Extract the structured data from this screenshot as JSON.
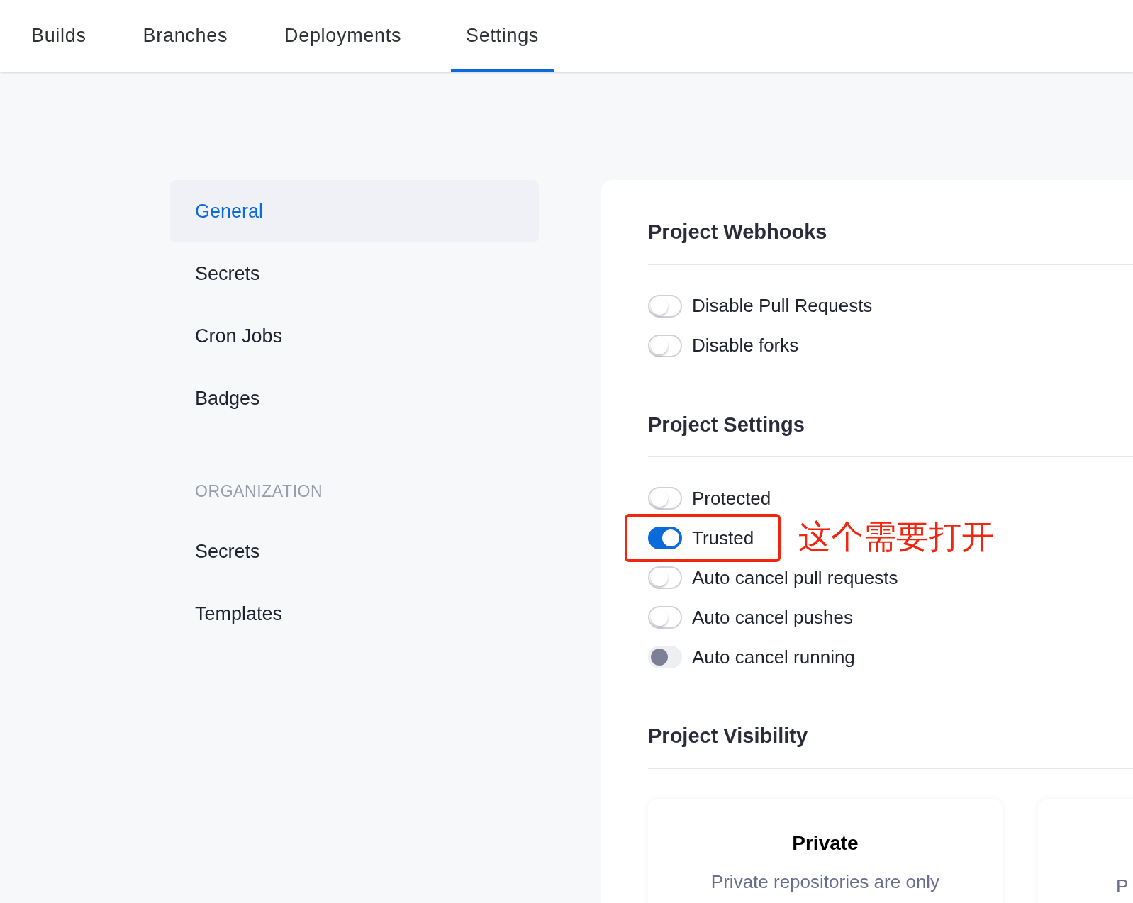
{
  "tabs": [
    {
      "label": "Builds",
      "selected": false
    },
    {
      "label": "Branches",
      "selected": false
    },
    {
      "label": "Deployments",
      "selected": false
    },
    {
      "label": "Settings",
      "selected": true
    }
  ],
  "sidebar": {
    "items": [
      {
        "label": "General",
        "selected": true
      },
      {
        "label": "Secrets",
        "selected": false
      },
      {
        "label": "Cron Jobs",
        "selected": false
      },
      {
        "label": "Badges",
        "selected": false
      }
    ],
    "organization": {
      "heading": "ORGANIZATION",
      "items": [
        {
          "label": "Secrets",
          "selected": false
        },
        {
          "label": "Templates",
          "selected": false
        }
      ]
    }
  },
  "sections": [
    {
      "title": "Project Webhooks",
      "toggles": [
        {
          "label": "Disable Pull Requests",
          "on": false,
          "disabled": false
        },
        {
          "label": "Disable forks",
          "on": false,
          "disabled": false
        }
      ]
    },
    {
      "title": "Project Settings",
      "toggles": [
        {
          "label": "Protected",
          "on": false,
          "disabled": false
        },
        {
          "label": "Trusted",
          "on": true,
          "disabled": false,
          "callout": "这个需要打开"
        },
        {
          "label": "Auto cancel pull requests",
          "on": false,
          "disabled": false
        },
        {
          "label": "Auto cancel pushes",
          "on": false,
          "disabled": false
        },
        {
          "label": "Auto cancel running",
          "on": false,
          "disabled": true
        }
      ]
    },
    {
      "title": "Project Visibility",
      "options": [
        {
          "title": "Private",
          "description": "Private repositories are only"
        },
        {
          "description": "P"
        }
      ]
    }
  ]
}
